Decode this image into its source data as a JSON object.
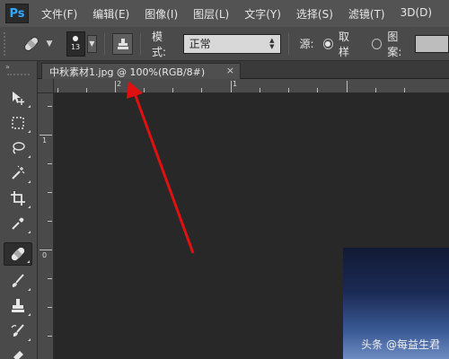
{
  "app": {
    "logo": "Ps"
  },
  "menu": {
    "items": [
      "文件(F)",
      "编辑(E)",
      "图像(I)",
      "图层(L)",
      "文字(Y)",
      "选择(S)",
      "滤镜(T)",
      "3D(D)"
    ]
  },
  "options": {
    "brush_size": "13",
    "mode_label": "模式:",
    "mode_value": "正常",
    "source_label": "源:",
    "sampled_label": "取样",
    "pattern_label": "图案:",
    "selected_source": "sampled"
  },
  "toolbar": {
    "header_glyph": "»",
    "tools": [
      {
        "name": "move-tool",
        "icon": "move-icon"
      },
      {
        "name": "marquee-tool",
        "icon": "marquee-icon"
      },
      {
        "name": "lasso-tool",
        "icon": "lasso-icon"
      },
      {
        "name": "magic-wand-tool",
        "icon": "magic-wand-icon"
      },
      {
        "name": "crop-tool",
        "icon": "crop-icon"
      },
      {
        "name": "eyedropper-tool",
        "icon": "eyedropper-icon"
      },
      {
        "name": "healing-brush-tool",
        "icon": "bandage-icon",
        "active": true
      },
      {
        "name": "brush-tool",
        "icon": "brush-icon"
      },
      {
        "name": "clone-stamp-tool",
        "icon": "stamp-icon"
      },
      {
        "name": "history-brush-tool",
        "icon": "history-brush-icon"
      },
      {
        "name": "eraser-tool",
        "icon": "eraser-icon"
      }
    ]
  },
  "document": {
    "tab_title": "中秋素材1.jpg @ 100%(RGB/8#)",
    "close_glyph": "×"
  },
  "rulers": {
    "top_labels": [
      "2",
      "1"
    ],
    "left_labels": [
      "1",
      "0"
    ]
  },
  "annotation": {
    "color": "#e01010"
  },
  "watermark": "头条 @每益生君"
}
